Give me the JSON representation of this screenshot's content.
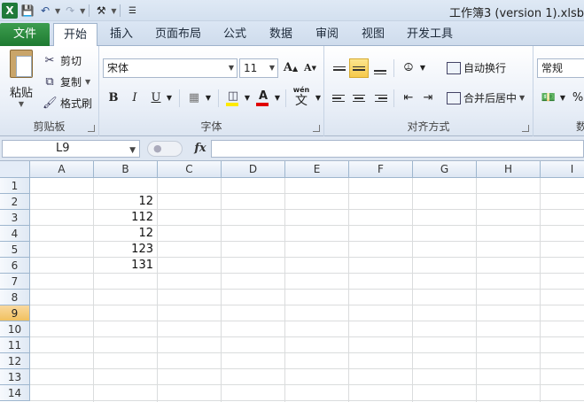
{
  "window": {
    "title": "工作簿3 (version 1).xlsb"
  },
  "quick_access": {
    "excel_logo": "X"
  },
  "tabs": [
    {
      "label": "文件"
    },
    {
      "label": "开始"
    },
    {
      "label": "插入"
    },
    {
      "label": "页面布局"
    },
    {
      "label": "公式"
    },
    {
      "label": "数据"
    },
    {
      "label": "审阅"
    },
    {
      "label": "视图"
    },
    {
      "label": "开发工具"
    }
  ],
  "active_tab": "开始",
  "ribbon": {
    "clipboard": {
      "paste": "粘贴",
      "cut": "剪切",
      "copy": "复制",
      "format_painter": "格式刷",
      "label": "剪贴板"
    },
    "font": {
      "name": "宋体",
      "size": "11",
      "label": "字体",
      "bold": "B",
      "italic": "I",
      "underline": "U",
      "grow": "A",
      "shrink": "A",
      "wen": "wén",
      "wen_char": "文"
    },
    "alignment": {
      "wrap": "自动换行",
      "merge": "合并后居中",
      "label": "对齐方式"
    },
    "number": {
      "format": "常规",
      "percent": "%",
      "label_partial": "数"
    }
  },
  "formula_bar": {
    "name_box": "L9",
    "fx": "fx",
    "formula": ""
  },
  "columns": [
    "A",
    "B",
    "C",
    "D",
    "E",
    "F",
    "G",
    "H",
    "I"
  ],
  "rows": [
    "1",
    "2",
    "3",
    "4",
    "5",
    "6",
    "7",
    "8",
    "9",
    "10",
    "11",
    "12",
    "13",
    "14"
  ],
  "selected_row": "9",
  "cells": [
    {
      "ref": "B2",
      "value": "12"
    },
    {
      "ref": "B3",
      "value": "112"
    },
    {
      "ref": "B4",
      "value": "12"
    },
    {
      "ref": "B5",
      "value": "123"
    },
    {
      "ref": "B6",
      "value": "131"
    }
  ],
  "colors": {
    "file_tab": "#2a8a3e",
    "selection": "#f6c94a",
    "header_border": "#9eb6ce"
  }
}
